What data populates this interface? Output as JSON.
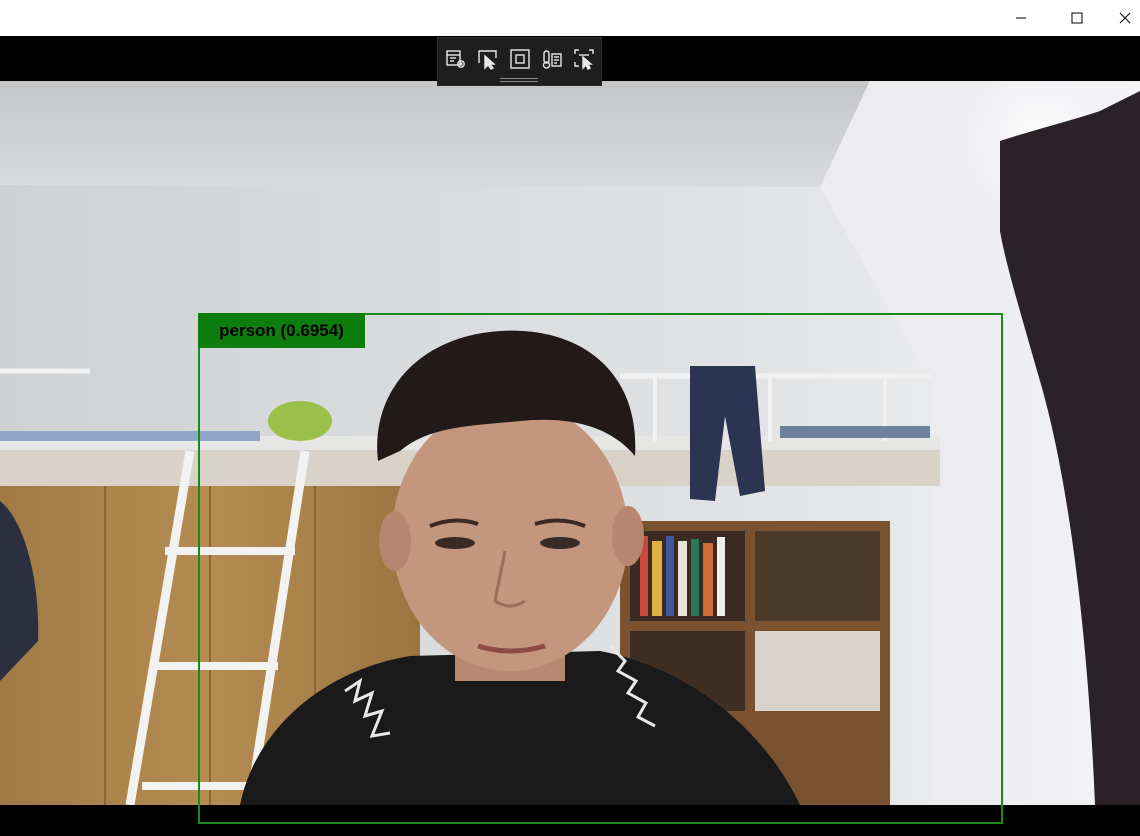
{
  "window": {
    "controls": {
      "minimize_icon": "minimize-icon",
      "maximize_icon": "maximize-icon",
      "close_icon": "close-icon"
    }
  },
  "toolbar": {
    "icons": [
      "settings-panel-icon",
      "select-pointer-icon",
      "frame-icon",
      "temperature-icon",
      "region-select-icon"
    ]
  },
  "detection": {
    "label": "person (0.6954)",
    "class": "person",
    "confidence": 0.6954,
    "box_color": "#1a8a1a",
    "label_bg": "#0d7d0d"
  },
  "colors": {
    "background": "#000000",
    "titlebar": "#ffffff",
    "toolbar": "#1e1e1e"
  }
}
